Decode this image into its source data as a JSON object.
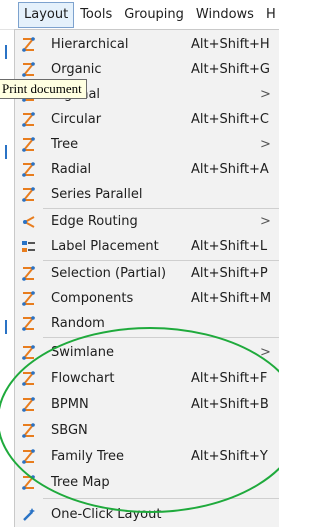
{
  "menubar": {
    "items": [
      "Layout",
      "Tools",
      "Grouping",
      "Windows",
      "H"
    ]
  },
  "tooltip": "Print document",
  "menu": {
    "items": [
      {
        "label": "Hierarchical",
        "shortcut": "Alt+Shift+H",
        "icon": "layout-icon"
      },
      {
        "label": "Organic",
        "shortcut": "Alt+Shift+G",
        "icon": "layout-icon"
      },
      {
        "label": "…gonal",
        "shortcut": "",
        "submenu": ">",
        "icon": "layout-icon"
      },
      {
        "label": "Circular",
        "shortcut": "Alt+Shift+C",
        "icon": "layout-icon"
      },
      {
        "label": "Tree",
        "shortcut": "",
        "submenu": ">",
        "icon": "layout-icon"
      },
      {
        "label": "Radial",
        "shortcut": "Alt+Shift+A",
        "icon": "layout-icon"
      },
      {
        "label": "Series Parallel",
        "shortcut": "",
        "icon": "layout-icon"
      },
      {
        "label": "Edge Routing",
        "shortcut": "",
        "submenu": ">",
        "icon": "edge-routing-icon"
      },
      {
        "label": "Label Placement",
        "shortcut": "Alt+Shift+L",
        "icon": "label-placement-icon"
      },
      {
        "label": "Selection (Partial)",
        "shortcut": "Alt+Shift+P",
        "icon": "layout-icon"
      },
      {
        "label": "Components",
        "shortcut": "Alt+Shift+M",
        "icon": "layout-icon"
      },
      {
        "label": "Random",
        "shortcut": "",
        "icon": "layout-icon"
      },
      {
        "label": "Swimlane",
        "shortcut": "",
        "submenu": ">",
        "icon": "layout-icon"
      },
      {
        "label": "Flowchart",
        "shortcut": "Alt+Shift+F",
        "icon": "layout-icon"
      },
      {
        "label": "BPMN",
        "shortcut": "Alt+Shift+B",
        "icon": "layout-icon"
      },
      {
        "label": "SBGN",
        "shortcut": "",
        "icon": "layout-icon"
      },
      {
        "label": "Family Tree",
        "shortcut": "Alt+Shift+Y",
        "icon": "layout-icon"
      },
      {
        "label": "Tree Map",
        "shortcut": "",
        "icon": "layout-icon"
      },
      {
        "label": "One-Click Layout",
        "shortcut": "",
        "icon": "magic-wand-icon"
      }
    ]
  },
  "colors": {
    "icon_orange": "#e87d1e",
    "icon_blue": "#2a73c5",
    "annotation_green": "#1faa3c"
  }
}
